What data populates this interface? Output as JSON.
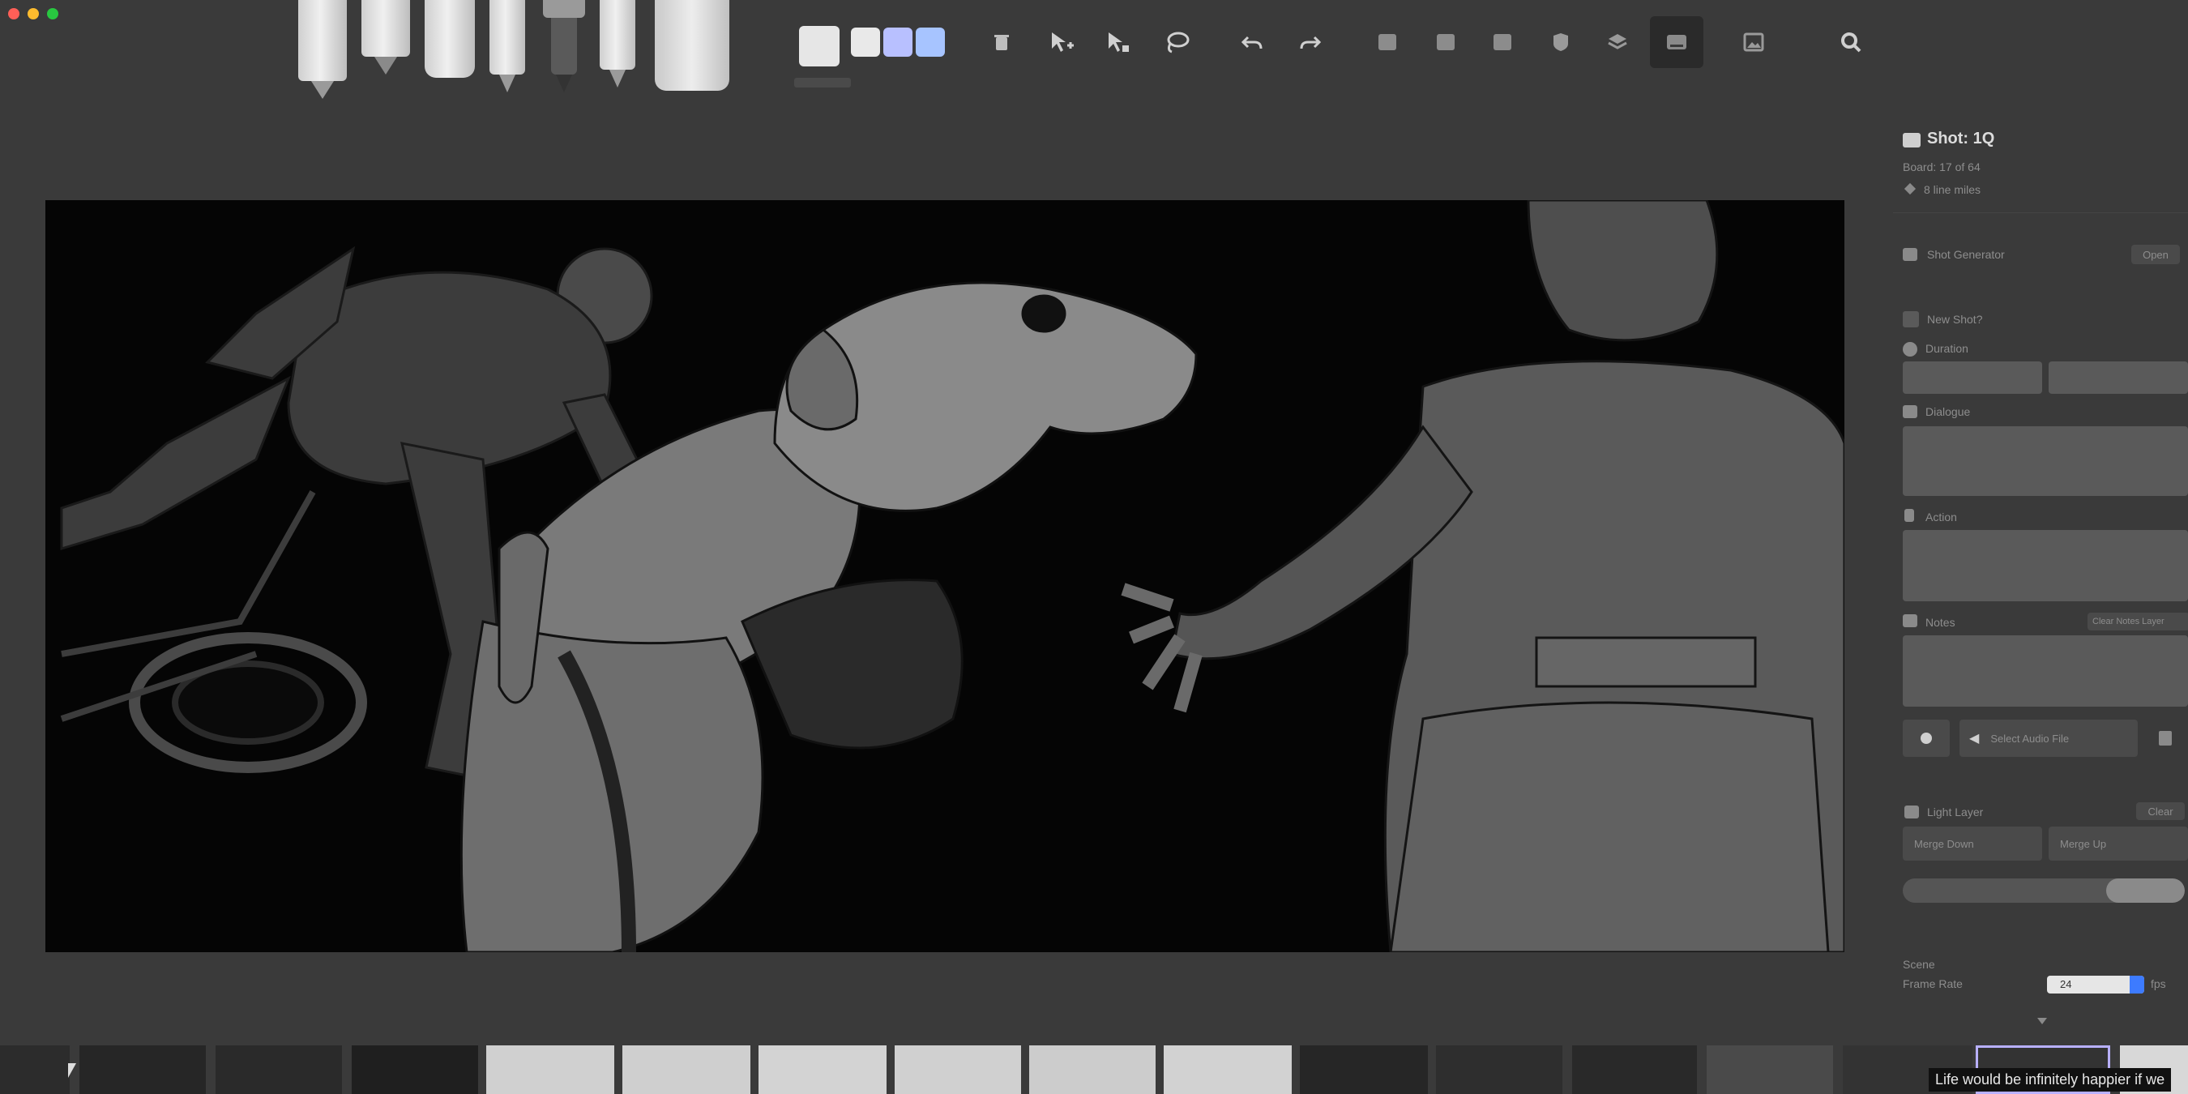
{
  "window": {
    "traffic_lights": [
      "#ff5f57",
      "#febc2e",
      "#28c840"
    ]
  },
  "toolbar": {
    "tool_icons": [
      "pencil-tool-icon",
      "marker-tool-icon",
      "brush-tool-icon",
      "pen-tool-icon",
      "fine-pen-icon",
      "pencil-thin-icon",
      "eraser-tool-icon"
    ],
    "swatch_colors": [
      "#e6e6e6",
      "#e9e9e9",
      "#b8c0ff",
      "#a7c4ff"
    ],
    "actions": [
      "trash-icon",
      "add-pointer-icon",
      "move-pointer-icon",
      "lasso-icon",
      "undo-icon",
      "redo-icon",
      "layer-1-icon",
      "layer-2-icon",
      "layer-3-icon",
      "shield-layer-icon",
      "stack-layer-icon",
      "board-view-icon",
      "image-icon",
      "search-icon"
    ]
  },
  "panel": {
    "shot_title": "Shot: 1Q",
    "board": "Board: 17 of 64",
    "line_miles": "8 line miles",
    "shot_generator_label": "Shot Generator",
    "shot_generator_open": "Open",
    "new_shot_label": "New Shot?",
    "duration_label": "Duration",
    "dialogue_label": "Dialogue",
    "action_label": "Action",
    "notes_label": "Notes",
    "clear_notes_label": "Clear Notes Layer",
    "select_audio_label": "Select Audio File",
    "light_layer_label": "Light Layer",
    "light_layer_clear": "Clear",
    "merge_down_label": "Merge Down",
    "merge_up_label": "Merge Up",
    "slider_value": 0.75,
    "scene_label": "Scene",
    "frame_rate_label": "Frame Rate",
    "frame_rate_value": "24",
    "fps_label": "fps"
  },
  "filmstrip": {
    "thumbnail_count": 17,
    "caption": "Life would be infinitely happier if we"
  }
}
